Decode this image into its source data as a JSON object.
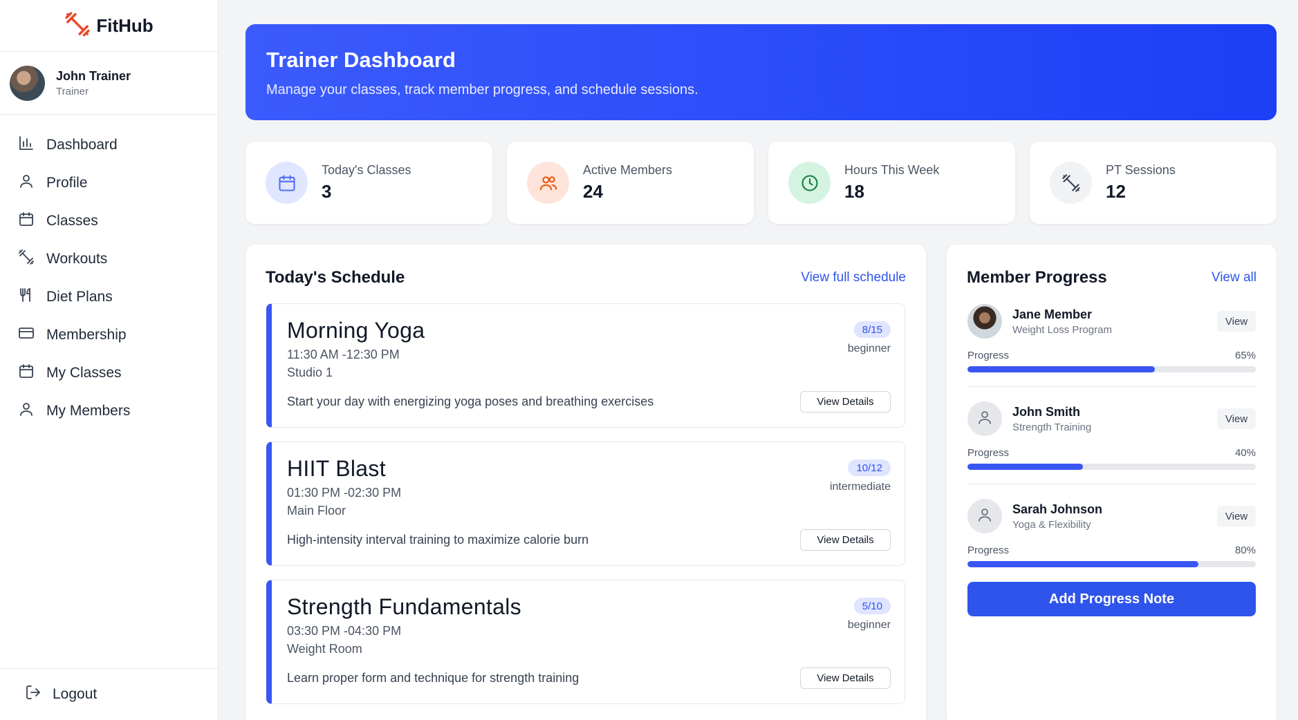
{
  "brand": {
    "name": "FitHub",
    "icon": "dumbbell-icon",
    "accent": "#ea4b2a"
  },
  "user": {
    "name": "John Trainer",
    "role": "Trainer"
  },
  "nav": {
    "items": [
      {
        "label": "Dashboard",
        "icon": "bar-chart-icon"
      },
      {
        "label": "Profile",
        "icon": "user-icon"
      },
      {
        "label": "Classes",
        "icon": "calendar-icon"
      },
      {
        "label": "Workouts",
        "icon": "dumbbell-icon"
      },
      {
        "label": "Diet Plans",
        "icon": "utensils-icon"
      },
      {
        "label": "Membership",
        "icon": "credit-card-icon"
      },
      {
        "label": "My Classes",
        "icon": "calendar-icon"
      },
      {
        "label": "My Members",
        "icon": "user-icon"
      }
    ],
    "logout": "Logout"
  },
  "banner": {
    "title": "Trainer Dashboard",
    "subtitle": "Manage your classes, track member progress, and schedule sessions."
  },
  "stats": [
    {
      "label": "Today's Classes",
      "value": "3",
      "icon": "calendar-icon",
      "color": "#4f6ef7"
    },
    {
      "label": "Active Members",
      "value": "24",
      "icon": "users-icon",
      "color": "#ea580c"
    },
    {
      "label": "Hours This Week",
      "value": "18",
      "icon": "clock-icon",
      "color": "#15803d"
    },
    {
      "label": "PT Sessions",
      "value": "12",
      "icon": "dumbbell-icon",
      "color": "#374151"
    }
  ],
  "schedule": {
    "title": "Today's Schedule",
    "link": "View full schedule",
    "classes": [
      {
        "title": "Morning Yoga",
        "time": "11:30 AM -12:30 PM",
        "room": "Studio 1",
        "description": "Start your day with energizing yoga poses and breathing exercises",
        "capacity": "8/15",
        "level": "beginner",
        "button": "View Details"
      },
      {
        "title": "HIIT Blast",
        "time": "01:30 PM -02:30 PM",
        "room": "Main Floor",
        "description": "High-intensity interval training to maximize calorie burn",
        "capacity": "10/12",
        "level": "intermediate",
        "button": "View Details"
      },
      {
        "title": "Strength Fundamentals",
        "time": "03:30 PM -04:30 PM",
        "room": "Weight Room",
        "description": "Learn proper form and technique for strength training",
        "capacity": "5/10",
        "level": "beginner",
        "button": "View Details"
      }
    ]
  },
  "progress": {
    "title": "Member Progress",
    "link": "View all",
    "members": [
      {
        "name": "Jane Member",
        "program": "Weight Loss Program",
        "label": "Progress",
        "percent_text": "65%",
        "percent": 65,
        "button": "View"
      },
      {
        "name": "John Smith",
        "program": "Strength Training",
        "label": "Progress",
        "percent_text": "40%",
        "percent": 40,
        "button": "View"
      },
      {
        "name": "Sarah Johnson",
        "program": "Yoga & Flexibility",
        "label": "Progress",
        "percent_text": "80%",
        "percent": 80,
        "button": "View"
      }
    ],
    "add_button": "Add Progress Note"
  },
  "colors": {
    "primary": "#2f54eb",
    "banner_start": "#3b5bfd",
    "banner_end": "#1d3ff5"
  }
}
